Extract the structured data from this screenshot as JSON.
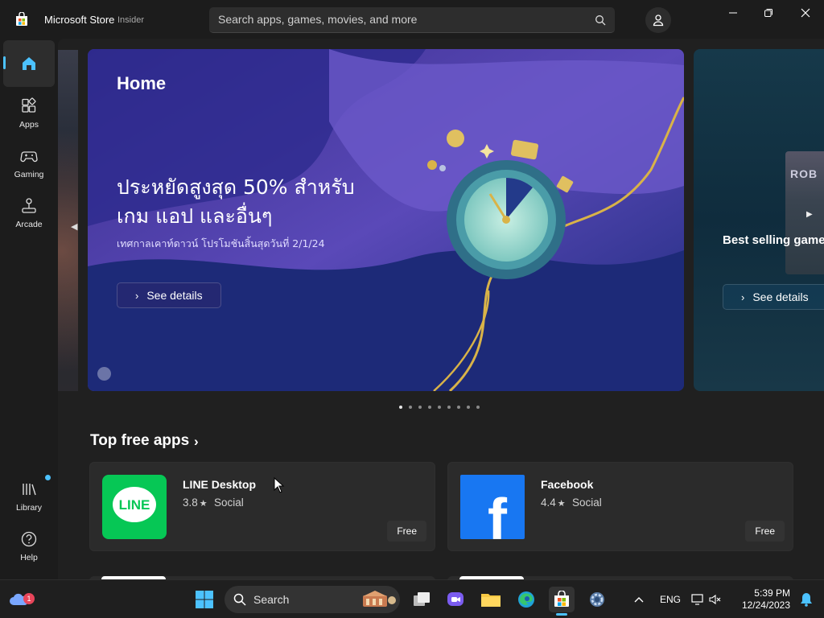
{
  "titlebar": {
    "app_title": "Microsoft Store",
    "badge": "Insider",
    "search_placeholder": "Search apps, games, movies, and more"
  },
  "sidebar": {
    "items": [
      {
        "label": "Home",
        "icon": "home-icon",
        "active": true
      },
      {
        "label": "Apps",
        "icon": "apps-icon"
      },
      {
        "label": "Gaming",
        "icon": "gamepad-icon"
      },
      {
        "label": "Arcade",
        "icon": "joystick-icon"
      },
      {
        "label": "Library",
        "icon": "library-icon",
        "has_update_dot": true
      },
      {
        "label": "Help",
        "icon": "help-icon"
      }
    ]
  },
  "hero": {
    "page_title": "Home",
    "headline": "ประหยัดสูงสุด 50% สำหรับเกม แอป และอื่นๆ",
    "subtext": "เทศกาลเคาท์ดาวน์ โปรโมชันสิ้นสุดวันที่ 2/1/24",
    "button_label": "See details",
    "next_title": "Best selling games",
    "next_button_label": "See details",
    "next_thumb_text": "ROB",
    "slide_count": 9,
    "active_slide": 0
  },
  "top_free": {
    "title": "Top free apps",
    "apps": [
      {
        "name": "LINE Desktop",
        "rating": "3.8",
        "category": "Social",
        "price": "Free",
        "icon_text": "LINE",
        "icon_color": "#06c755"
      },
      {
        "name": "Facebook",
        "rating": "4.4",
        "category": "Social",
        "price": "Free",
        "icon_text": "f",
        "icon_color": "#1877f2"
      }
    ]
  },
  "taskbar": {
    "search_label": "Search",
    "language": "ENG",
    "time": "5:39 PM",
    "date": "12/24/2023",
    "weather_badge": "1"
  },
  "colors": {
    "accent": "#4cc2ff",
    "line_green": "#06c755",
    "facebook_blue": "#1877f2"
  }
}
